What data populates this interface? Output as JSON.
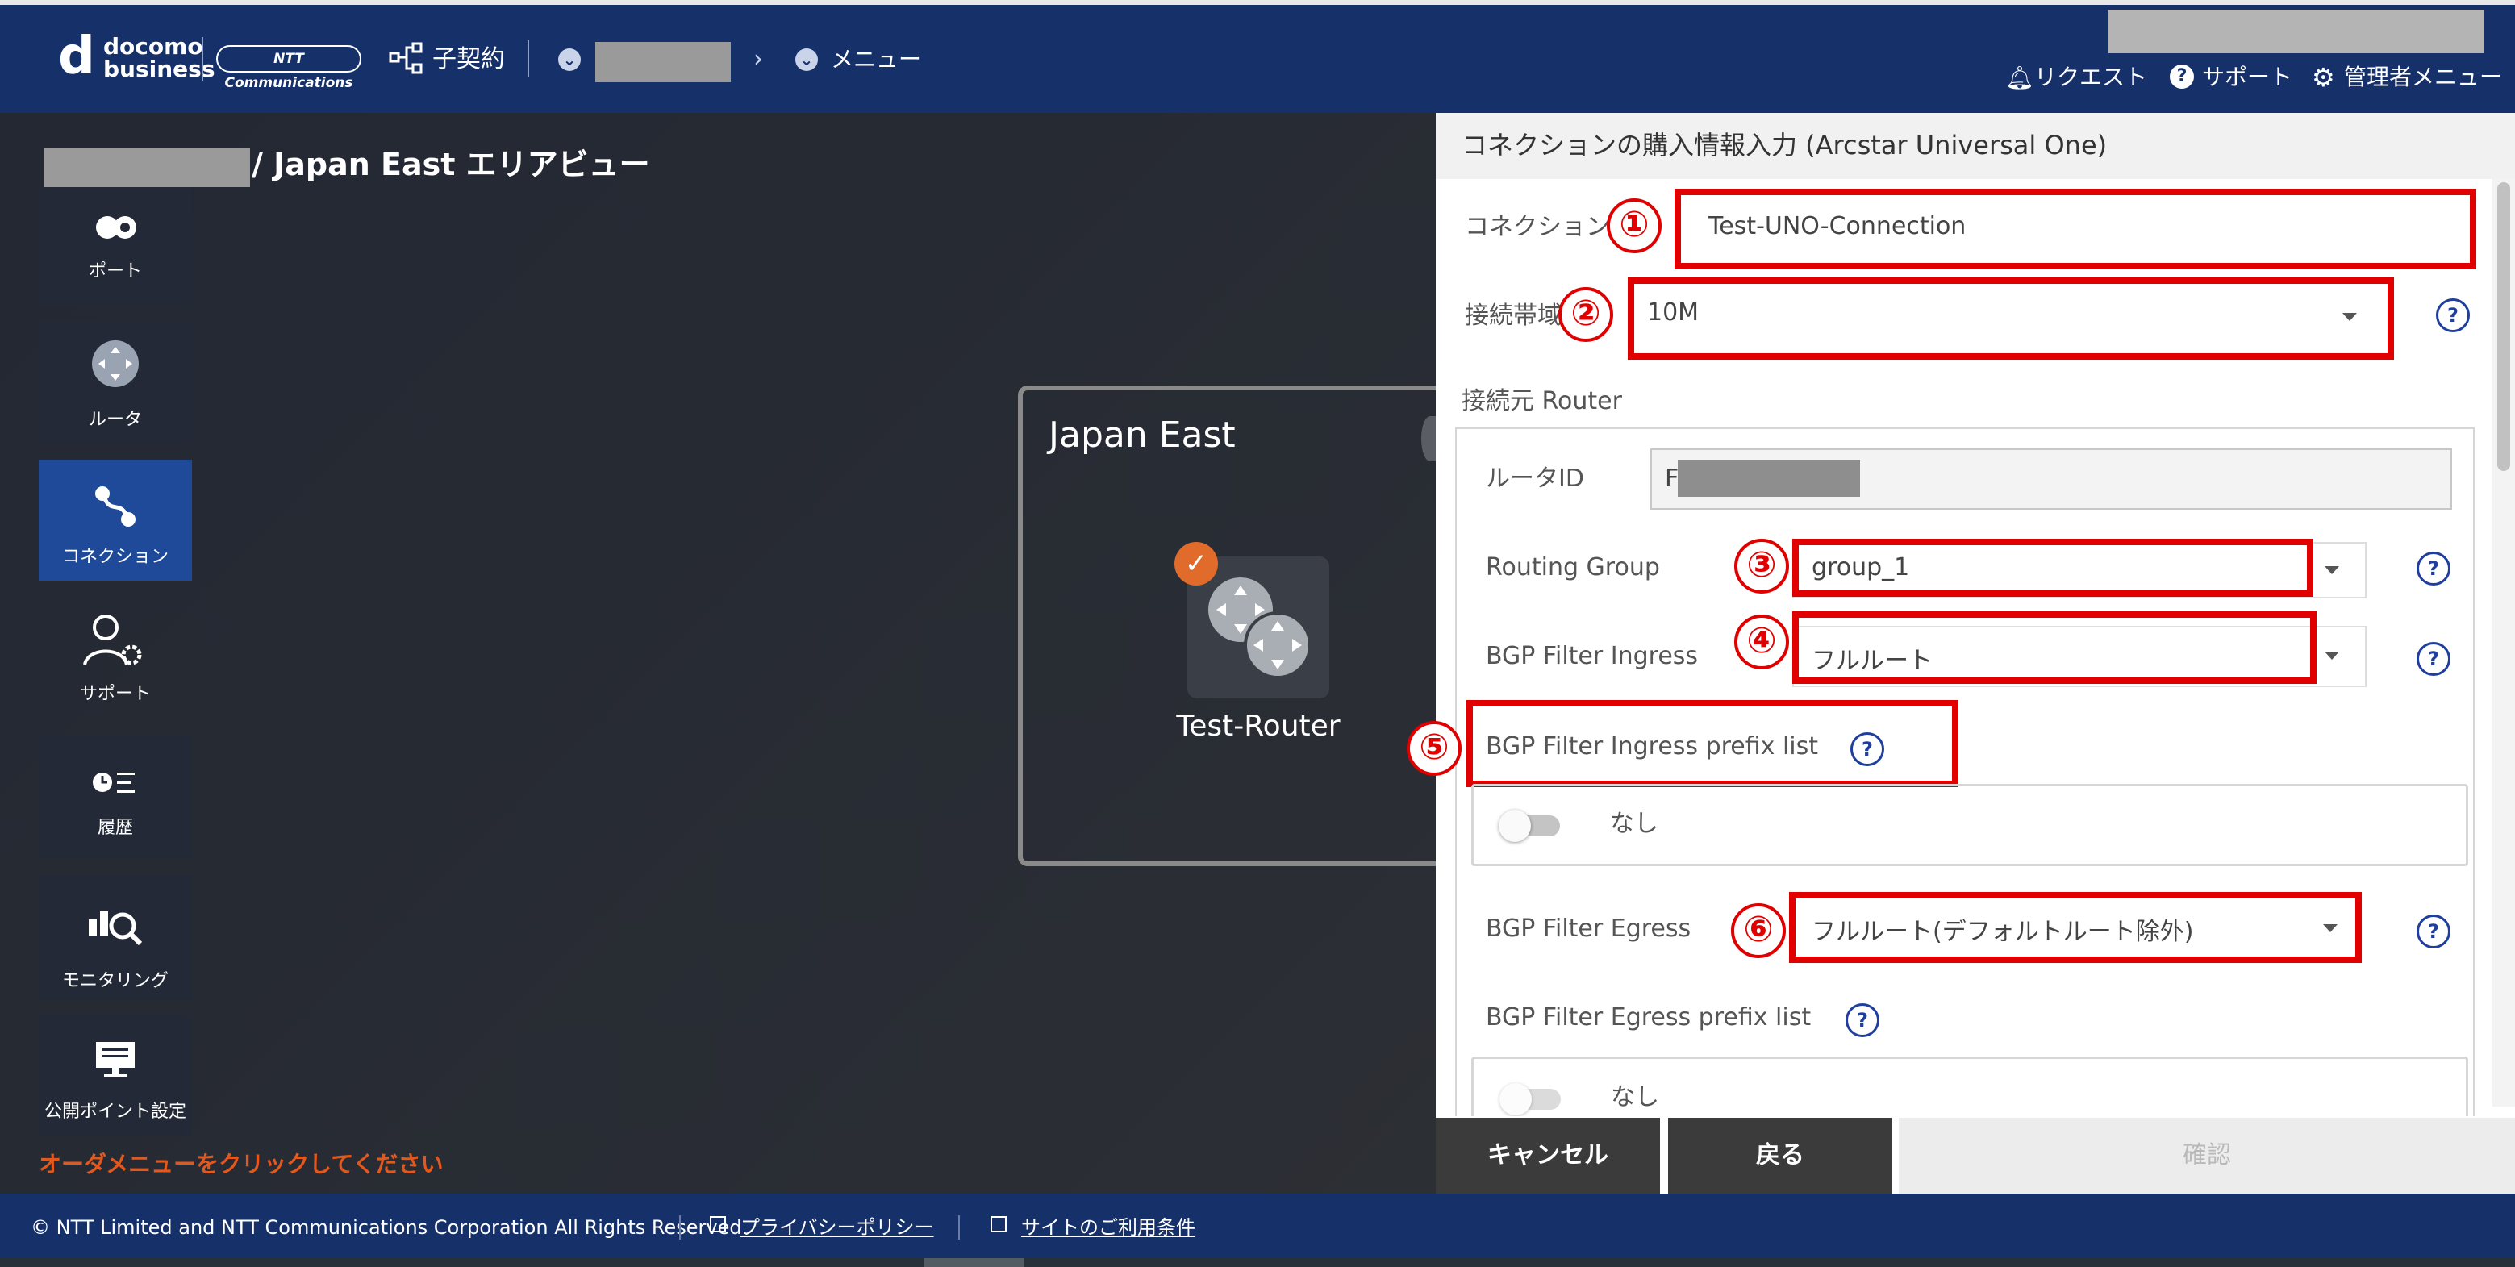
{
  "header": {
    "logo_d": "d",
    "logo_words": "docomo business",
    "ntt_badge": "NTT Communications",
    "breadcrumb_contract": "子契約",
    "breadcrumb_menu": "メニュー",
    "links": {
      "request": "リクエスト",
      "support": "サポート",
      "admin_menu": "管理者メニュー"
    }
  },
  "area_title": "/ Japan East エリアビュー",
  "sidebar": {
    "items": [
      {
        "label": "ポート",
        "icon": "port-icon"
      },
      {
        "label": "ルータ",
        "icon": "router-icon"
      },
      {
        "label": "コネクション",
        "icon": "connection-icon",
        "active": true
      },
      {
        "label": "サポート",
        "icon": "support-user-icon"
      },
      {
        "label": "履歴",
        "icon": "history-icon"
      },
      {
        "label": "モニタリング",
        "icon": "monitoring-icon"
      },
      {
        "label": "公開ポイント設定",
        "icon": "public-point-icon"
      }
    ]
  },
  "canvas": {
    "region_title": "Japan East",
    "router_label": "Test-Router"
  },
  "order_message": "オーダメニューをクリックしてください",
  "panel": {
    "title": "コネクションの購入情報入力 (Arcstar Universal One)",
    "connection_name": {
      "label": "コネクション名",
      "value": "Test-UNO-Connection",
      "marker": "①"
    },
    "bandwidth": {
      "label": "接続帯域",
      "value": "10M",
      "marker": "②"
    },
    "source_router_section": "接続元 Router",
    "router_id": {
      "label": "ルータID",
      "value": "F"
    },
    "routing_group": {
      "label": "Routing Group",
      "value": "group_1",
      "marker": "③"
    },
    "bgp_ingress": {
      "label": "BGP Filter Ingress",
      "value": "フルルート",
      "marker": "④"
    },
    "bgp_ingress_prefix": {
      "label": "BGP Filter Ingress prefix list",
      "toggle_text": "なし",
      "marker": "⑤"
    },
    "bgp_egress": {
      "label": "BGP Filter Egress",
      "value": "フルルート(デフォルトルート除外)",
      "marker": "⑥"
    },
    "bgp_egress_prefix": {
      "label": "BGP Filter Egress prefix list",
      "toggle_text": "なし"
    }
  },
  "buttons": {
    "cancel": "キャンセル",
    "back": "戻る",
    "confirm": "確認"
  },
  "footer": {
    "copyright": "© NTT Limited and NTT Communications Corporation All Rights Reserved.",
    "privacy": "プライバシーポリシー",
    "terms": "サイトのご利用条件"
  },
  "colors": {
    "header_bg": "#16306a",
    "accent_red": "#e00000",
    "active_nav": "#1f4a9a",
    "order_orange": "#e2581d"
  }
}
